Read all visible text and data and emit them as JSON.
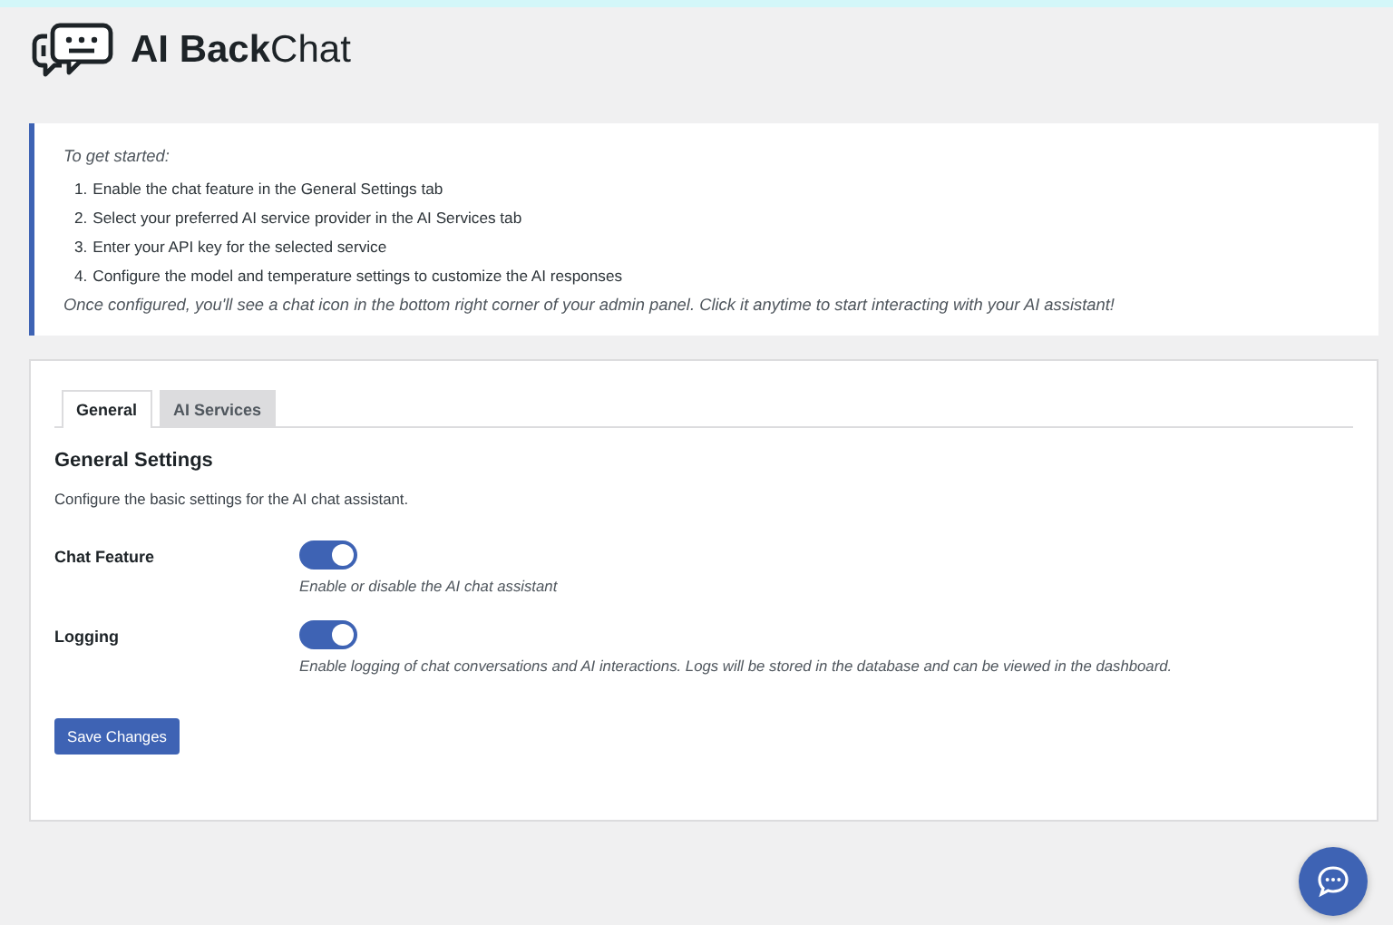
{
  "brand": {
    "title": "**AI Back**Chat"
  },
  "notice": {
    "intro": "To get started:",
    "steps": [
      {
        "number": "1.",
        "text": "Enable the chat feature in the General Settings tab"
      },
      {
        "number": "2.",
        "text": "Select your preferred AI service provider in the AI Services tab"
      },
      {
        "number": "3.",
        "text": "Enter your API key for the selected service"
      },
      {
        "number": "4.",
        "text": "Configure the model and temperature settings to customize the AI responses"
      }
    ],
    "outro": "Once configured, you'll see a chat icon in the bottom right corner of your admin panel. Click it anytime to start interacting with your AI assistant!"
  },
  "tabs": [
    {
      "label": "General",
      "selected": true
    },
    {
      "label": "AI Services",
      "selected": false
    }
  ],
  "section": {
    "title": "General Settings",
    "description": "Configure the basic settings for the AI chat assistant."
  },
  "settings": [
    {
      "label": "Chat Feature",
      "on": true,
      "description": "Enable or disable the AI chat assistant"
    },
    {
      "label": "Logging",
      "on": true,
      "description": "Enable logging of chat conversations and AI interactions. Logs will be stored in the database and can be viewed in the dashboard."
    }
  ],
  "save_button": "Save Changes"
}
